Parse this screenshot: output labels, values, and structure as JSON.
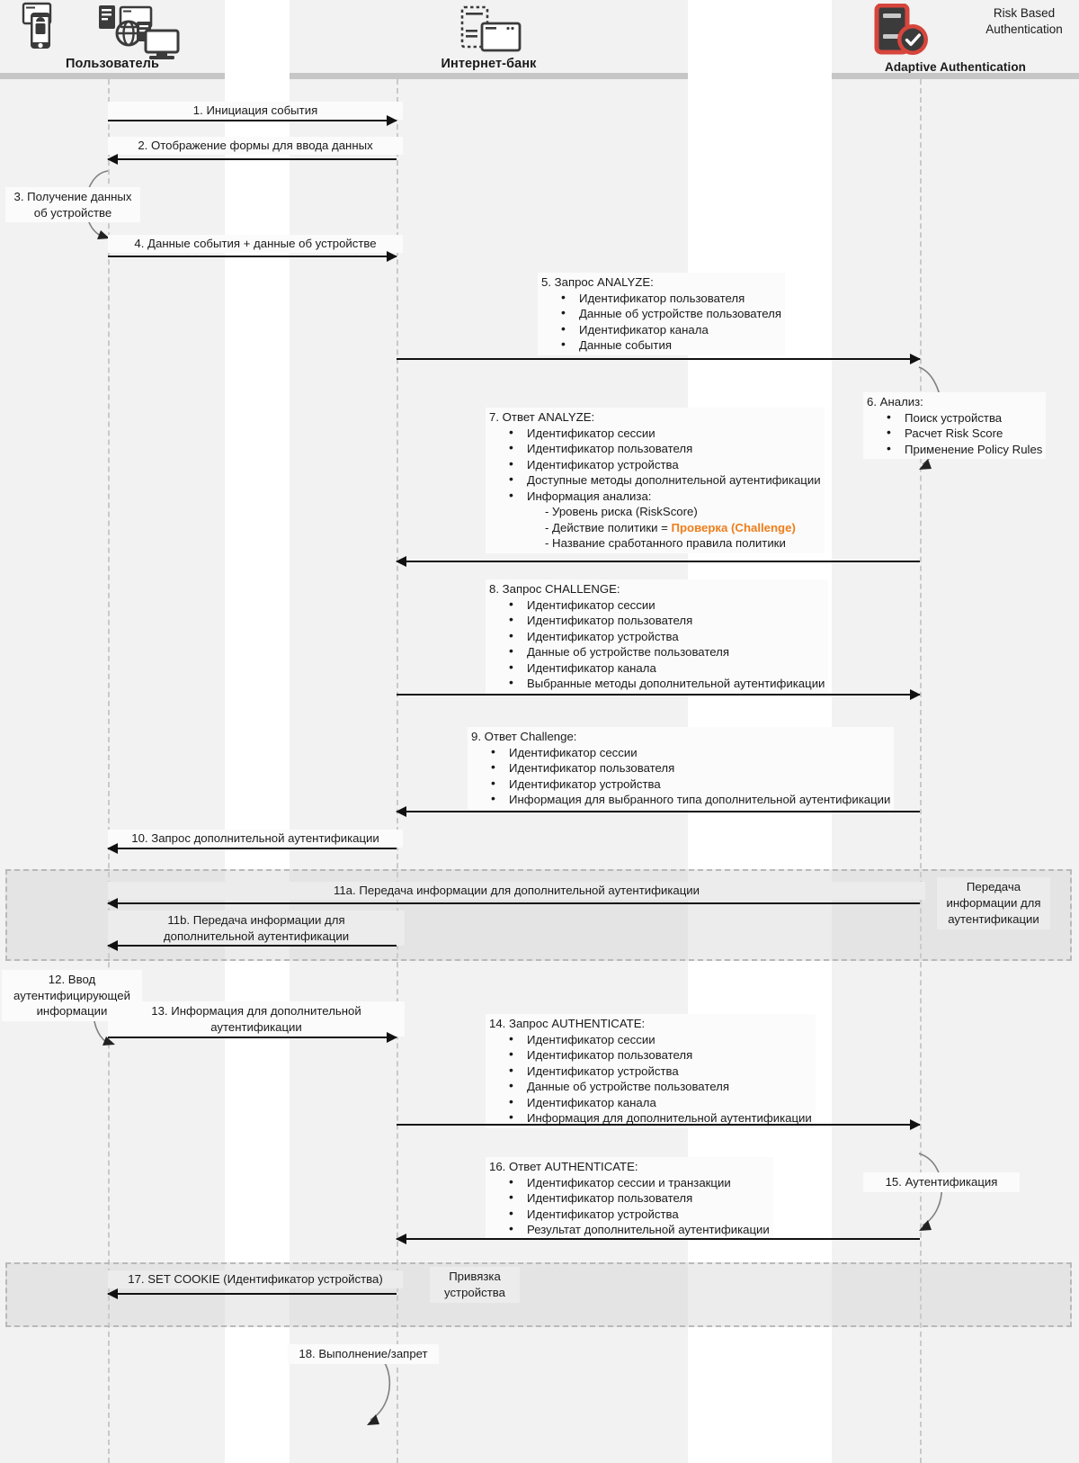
{
  "diagram": {
    "title": "Risk Based Authentication sequence diagram",
    "accent_orange": "#ef7d1a",
    "band_color": "#f2f2f2",
    "actors": [
      {
        "id": "user",
        "label": "Пользователь",
        "icon": "user-devices-icon"
      },
      {
        "id": "bank",
        "label": "Интернет-банк",
        "icon": "internet-bank-icon"
      },
      {
        "id": "aa",
        "label": "Adaptive Authentication",
        "caption": "Risk Based\nAuthentication",
        "caption_line1": "Risk Based",
        "caption_line2": "Authentication",
        "icon": "server-check-icon"
      }
    ]
  },
  "messages": {
    "m1": {
      "label": "1. Инициация события"
    },
    "m2": {
      "label": "2. Отображение формы для ввода данных"
    },
    "m3": {
      "line1": "3. Получение данных",
      "line2": "об устройстве"
    },
    "m4": {
      "label": "4. Данные события + данные об устройстве"
    },
    "m5": {
      "title": "5. Запрос ANALYZE:",
      "items": [
        "Идентификатор пользователя",
        "Данные об устройстве пользователя",
        "Идентификатор канала",
        "Данные события"
      ]
    },
    "m6": {
      "title": "6. Анализ:",
      "items": [
        "Поиск устройства",
        "Расчет Risk Score",
        "Применение Policy Rules"
      ]
    },
    "m7": {
      "title": "7. Ответ ANALYZE:",
      "items": [
        "Идентификатор сессии",
        "Идентификатор пользователя",
        "Идентификатор устройства",
        "Доступные методы дополнительной аутентификации",
        "Информация анализа:"
      ],
      "sub1": "-  Уровень риска (RiskScore)",
      "sub2_prefix": "-  Действие политики = ",
      "sub2_highlight": "Проверка (Challenge)",
      "sub3": "-  Название сработанного правила политики"
    },
    "m8": {
      "title": "8. Запрос CHALLENGE:",
      "items": [
        "Идентификатор сессии",
        "Идентификатор пользователя",
        "Идентификатор устройства",
        "Данные об устройстве пользователя",
        "Идентификатор канала",
        "Выбранные методы дополнительной аутентификации"
      ]
    },
    "m9": {
      "title": "9. Ответ Challenge:",
      "items": [
        "Идентификатор сессии",
        "Идентификатор пользователя",
        "Идентификатор устройства",
        "Информация для выбранного типа дополнительной аутентификации"
      ]
    },
    "m10": {
      "label": "10. Запрос дополнительной аутентификации"
    },
    "m11a": {
      "label": "11a. Передача информации для дополнительной аутентификации"
    },
    "m11b": {
      "line1": "11b. Передача информации для",
      "line2": "дополнительной аутентификации"
    },
    "m12": {
      "line1": "12. Ввод",
      "line2": "аутентифицирующей",
      "line3": "информации"
    },
    "m13": {
      "line1": "13. Информация для дополнительной",
      "line2": "аутентификации"
    },
    "m14": {
      "title": "14. Запрос AUTHENTICATE:",
      "items": [
        "Идентификатор сессии",
        "Идентификатор пользователя",
        "Идентификатор устройства",
        "Данные об устройстве пользователя",
        "Идентификатор канала",
        "Информация для дополнительной аутентификации"
      ]
    },
    "m15": {
      "label": "15. Аутентификация"
    },
    "m16": {
      "title": "16. Ответ AUTHENTICATE:",
      "items": [
        "Идентификатор сессии и транзакции",
        "Идентификатор пользователя",
        "Идентификатор устройства",
        "Результат дополнительной аутентификации"
      ]
    },
    "m17": {
      "label": "17. SET COOKIE (Идентификатор устройства)"
    },
    "m18": {
      "label": "18. Выполнение/запрет"
    }
  },
  "fragments": {
    "transfer": {
      "line1": "Передача",
      "line2": "информации для",
      "line3": "аутентификации"
    },
    "binding": {
      "line1": "Привязка",
      "line2": "устройства"
    }
  }
}
